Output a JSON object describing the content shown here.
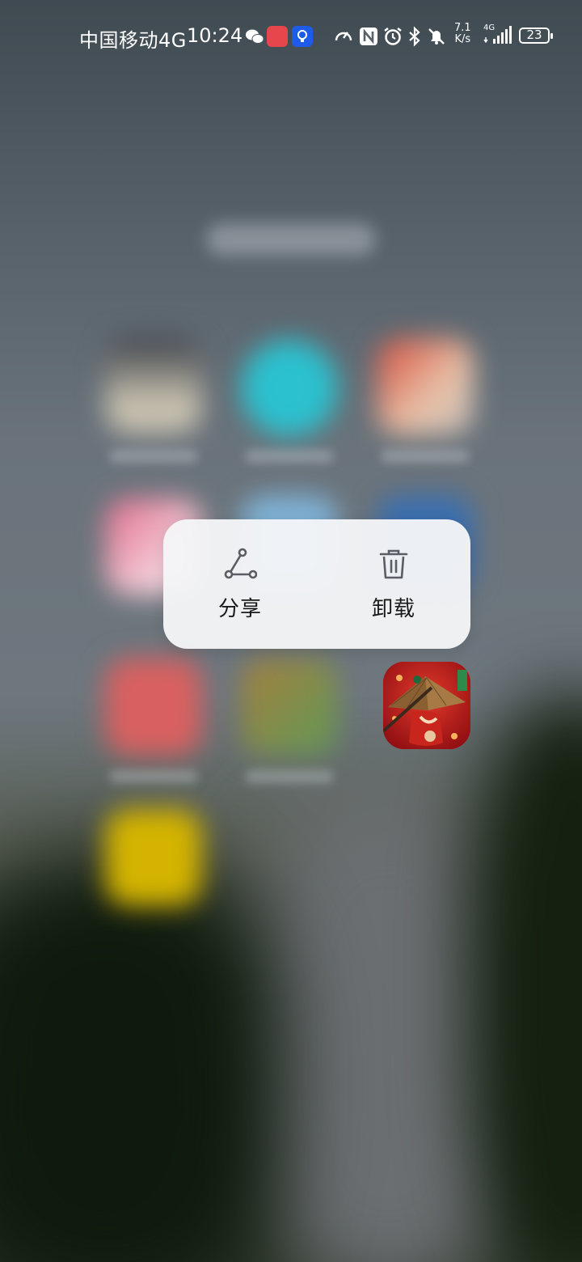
{
  "status_bar": {
    "carrier": "中国移动4G",
    "time": "10:24",
    "net_speed_value": "7.1",
    "net_speed_unit": "K/s",
    "network_type": "4G",
    "battery": "23",
    "icons": [
      "wechat-icon",
      "huawei-store-icon",
      "lightbulb-app-icon",
      "speedometer-icon",
      "nfc-icon",
      "alarm-icon",
      "bluetooth-icon",
      "mute-bell-icon",
      "signal-icon",
      "battery-icon"
    ]
  },
  "context_menu": {
    "items": [
      {
        "label": "分享",
        "icon": "share-icon"
      },
      {
        "label": "卸载",
        "icon": "trash-icon"
      }
    ]
  },
  "focused_app": {
    "icon": "game-app-icon"
  },
  "colors": {
    "menu_bg": "#f4f5f7",
    "menu_text": "#1a1a1a",
    "icon_stroke": "#5a5d63",
    "game_red": "#b5141b"
  }
}
